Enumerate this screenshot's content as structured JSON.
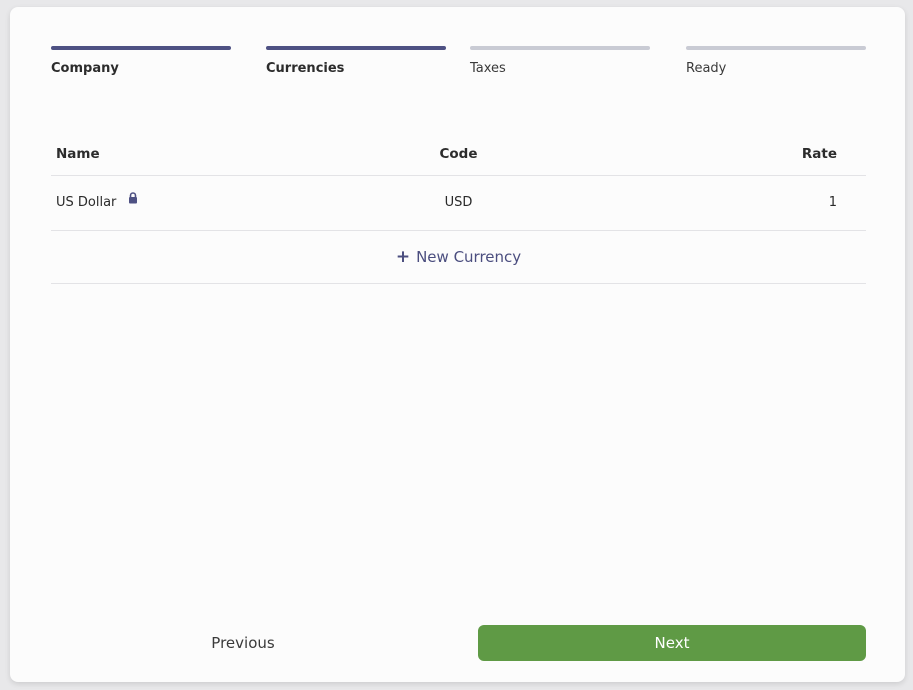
{
  "steps": [
    {
      "label": "Company",
      "state": "done"
    },
    {
      "label": "Currencies",
      "state": "done"
    },
    {
      "label": "Taxes",
      "state": "pending"
    },
    {
      "label": "Ready",
      "state": "pending"
    }
  ],
  "table": {
    "headers": {
      "name": "Name",
      "code": "Code",
      "rate": "Rate"
    },
    "rows": [
      {
        "name": "US Dollar",
        "code": "USD",
        "rate": "1",
        "locked": true,
        "icon": "lock-icon"
      }
    ],
    "add_label": "New Currency"
  },
  "footer": {
    "previous_label": "Previous",
    "next_label": "Next"
  },
  "colors": {
    "accent": "#4e5183",
    "step_pending": "#c9cbd4",
    "next_button": "#5f9a45"
  }
}
